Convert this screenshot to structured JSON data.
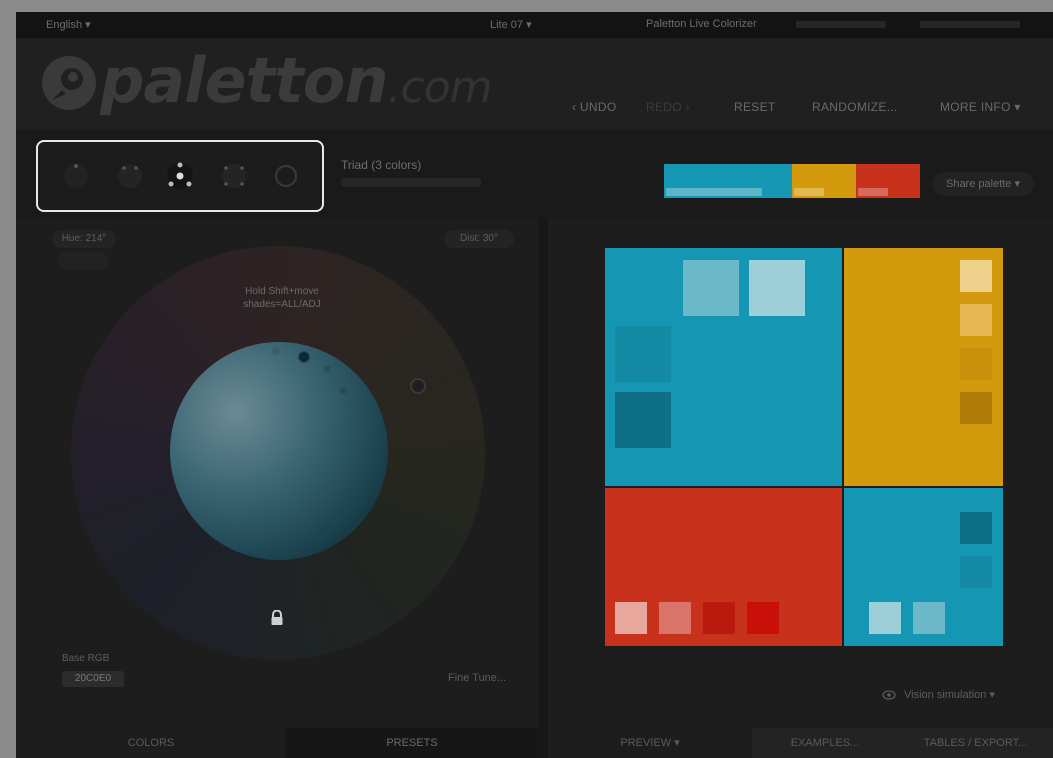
{
  "topbar": {
    "language": "English ▾",
    "version": "Lite 07 ▾",
    "app_name": "Paletton Live Colorizer"
  },
  "header": {
    "logo_text": "paletton",
    "logo_domain": ".com",
    "nav": [
      "‹ UNDO",
      "REDO ›",
      "RESET",
      "RANDOMIZE...",
      "MORE INFO ▾"
    ]
  },
  "scheme": {
    "title": "Triad (3 colors)",
    "icons": [
      "mono-icon",
      "adjacent-icon",
      "triad-icon",
      "tetrad-icon",
      "free-icon"
    ]
  },
  "palette": {
    "share_label": "Share palette ▾",
    "colors": {
      "primary": "#1597b4",
      "secondary": "#d49a0d",
      "tertiary": "#c8311c"
    }
  },
  "wheel": {
    "hue_label": "Hue: 214°",
    "dist_label": "Dist: 30°",
    "hint": "Hold Shift+move shades=ALL/ADJ",
    "base_label": "Base RGB",
    "base_value": "20C0E0",
    "fine_tune": "Fine Tune..."
  },
  "tabs": {
    "colors": "COLORS",
    "presets": "PRESETS",
    "preview": "PREVIEW ▾",
    "examples": "EXAMPLES...",
    "tables": "TABLES / EXPORT..."
  },
  "vision": {
    "label": "Vision simulation ▾",
    "icon": "eye-icon"
  }
}
